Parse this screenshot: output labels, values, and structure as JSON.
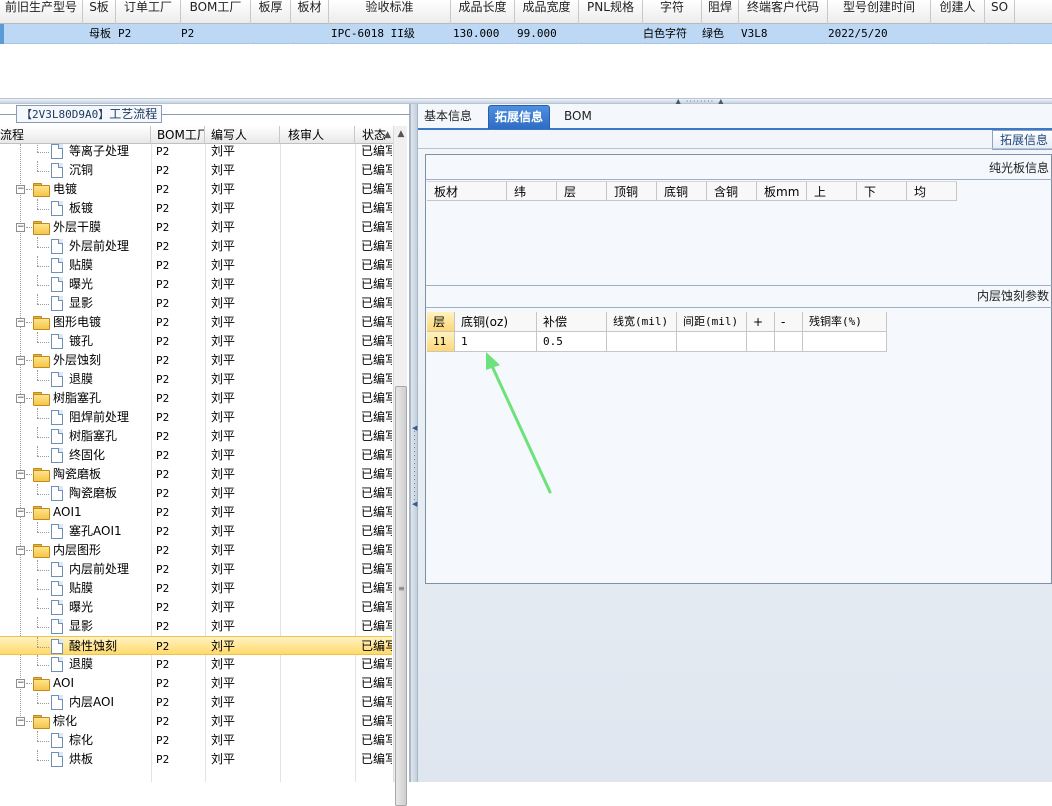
{
  "top_grid": {
    "headers": [
      "前旧生产型号",
      "S板",
      "订单工厂",
      "BOM工厂",
      "板厚",
      "板材",
      "验收标准",
      "成品长度",
      "成品宽度",
      "PNL规格",
      "字符",
      "阻焊",
      "终端客户代码",
      "型号创建时间",
      "创建人",
      "SO"
    ],
    "row": [
      "母板",
      "P2",
      "P2",
      "",
      "",
      "IPC-6018 II级",
      "130.000",
      "99.000",
      "",
      "白色字符",
      "绿色",
      "V3L8",
      "2022/5/20",
      "",
      ""
    ]
  },
  "left_panel": {
    "title_code": "【2V3L80D9A0】",
    "title_text": "工艺流程",
    "columns": [
      "流程",
      "BOM工厂",
      "编写人",
      "核审人",
      "状态"
    ],
    "rows": [
      {
        "name": "等离子处理",
        "factory": "P2",
        "author": "刘平",
        "status": "已编写",
        "level": 1,
        "folder": false
      },
      {
        "name": "沉铜",
        "factory": "P2",
        "author": "刘平",
        "status": "已编写",
        "level": 1,
        "folder": false
      },
      {
        "name": "电镀",
        "factory": "P2",
        "author": "刘平",
        "status": "已编写",
        "level": 0,
        "folder": true
      },
      {
        "name": "板镀",
        "factory": "P2",
        "author": "刘平",
        "status": "已编写",
        "level": 1,
        "folder": false
      },
      {
        "name": "外层干膜",
        "factory": "P2",
        "author": "刘平",
        "status": "已编写",
        "level": 0,
        "folder": true
      },
      {
        "name": "外层前处理",
        "factory": "P2",
        "author": "刘平",
        "status": "已编写",
        "level": 1,
        "folder": false
      },
      {
        "name": "贴膜",
        "factory": "P2",
        "author": "刘平",
        "status": "已编写",
        "level": 1,
        "folder": false
      },
      {
        "name": "曝光",
        "factory": "P2",
        "author": "刘平",
        "status": "已编写",
        "level": 1,
        "folder": false
      },
      {
        "name": "显影",
        "factory": "P2",
        "author": "刘平",
        "status": "已编写",
        "level": 1,
        "folder": false
      },
      {
        "name": "图形电镀",
        "factory": "P2",
        "author": "刘平",
        "status": "已编写",
        "level": 0,
        "folder": true
      },
      {
        "name": "镀孔",
        "factory": "P2",
        "author": "刘平",
        "status": "已编写",
        "level": 1,
        "folder": false
      },
      {
        "name": "外层蚀刻",
        "factory": "P2",
        "author": "刘平",
        "status": "已编写",
        "level": 0,
        "folder": true
      },
      {
        "name": "退膜",
        "factory": "P2",
        "author": "刘平",
        "status": "已编写",
        "level": 1,
        "folder": false
      },
      {
        "name": "树脂塞孔",
        "factory": "P2",
        "author": "刘平",
        "status": "已编写",
        "level": 0,
        "folder": true
      },
      {
        "name": "阻焊前处理",
        "factory": "P2",
        "author": "刘平",
        "status": "已编写",
        "level": 1,
        "folder": false
      },
      {
        "name": "树脂塞孔",
        "factory": "P2",
        "author": "刘平",
        "status": "已编写",
        "level": 1,
        "folder": false
      },
      {
        "name": "终固化",
        "factory": "P2",
        "author": "刘平",
        "status": "已编写",
        "level": 1,
        "folder": false
      },
      {
        "name": "陶瓷磨板",
        "factory": "P2",
        "author": "刘平",
        "status": "已编写",
        "level": 0,
        "folder": true
      },
      {
        "name": "陶瓷磨板",
        "factory": "P2",
        "author": "刘平",
        "status": "已编写",
        "level": 1,
        "folder": false
      },
      {
        "name": "AOI1",
        "factory": "P2",
        "author": "刘平",
        "status": "已编写",
        "level": 0,
        "folder": true
      },
      {
        "name": "塞孔AOI1",
        "factory": "P2",
        "author": "刘平",
        "status": "已编写",
        "level": 1,
        "folder": false
      },
      {
        "name": "内层图形",
        "factory": "P2",
        "author": "刘平",
        "status": "已编写",
        "level": 0,
        "folder": true
      },
      {
        "name": "内层前处理",
        "factory": "P2",
        "author": "刘平",
        "status": "已编写",
        "level": 1,
        "folder": false
      },
      {
        "name": "贴膜",
        "factory": "P2",
        "author": "刘平",
        "status": "已编写",
        "level": 1,
        "folder": false
      },
      {
        "name": "曝光",
        "factory": "P2",
        "author": "刘平",
        "status": "已编写",
        "level": 1,
        "folder": false
      },
      {
        "name": "显影",
        "factory": "P2",
        "author": "刘平",
        "status": "已编写",
        "level": 1,
        "folder": false
      },
      {
        "name": "酸性蚀刻",
        "factory": "P2",
        "author": "刘平",
        "status": "已编写",
        "level": 1,
        "folder": false,
        "selected": true
      },
      {
        "name": "退膜",
        "factory": "P2",
        "author": "刘平",
        "status": "已编写",
        "level": 1,
        "folder": false
      },
      {
        "name": "AOI",
        "factory": "P2",
        "author": "刘平",
        "status": "已编写",
        "level": 0,
        "folder": true
      },
      {
        "name": "内层AOI",
        "factory": "P2",
        "author": "刘平",
        "status": "已编写",
        "level": 1,
        "folder": false
      },
      {
        "name": "棕化",
        "factory": "P2",
        "author": "刘平",
        "status": "已编写",
        "level": 0,
        "folder": true
      },
      {
        "name": "棕化",
        "factory": "P2",
        "author": "刘平",
        "status": "已编写",
        "level": 1,
        "folder": false
      },
      {
        "name": "烘板",
        "factory": "P2",
        "author": "刘平",
        "status": "已编写",
        "level": 1,
        "folder": false
      }
    ]
  },
  "right_panel": {
    "tabs": [
      "基本信息",
      "拓展信息",
      "BOM"
    ],
    "active_tab": "拓展信息",
    "ext_button": "拓展信息",
    "section1_title": "纯光板信息",
    "section1_columns": [
      "板材",
      "纬",
      "层",
      "顶铜",
      "底铜",
      "含铜",
      "板mm",
      "上",
      "下",
      "均"
    ],
    "section2_title": "内层蚀刻参数",
    "section2_columns": [
      "层",
      "底铜(oz)",
      "补偿",
      "线宽(mil)",
      "间距(mil)",
      "+",
      "-",
      "残铜率(%)"
    ],
    "section2_rows": [
      [
        "11",
        "1",
        "0.5",
        "",
        "",
        "",
        "",
        ""
      ]
    ]
  },
  "colors": {
    "accent": "#2f6cc4",
    "selected_row": "#ffd96b",
    "annotation_arrow": "#6ee27a"
  }
}
